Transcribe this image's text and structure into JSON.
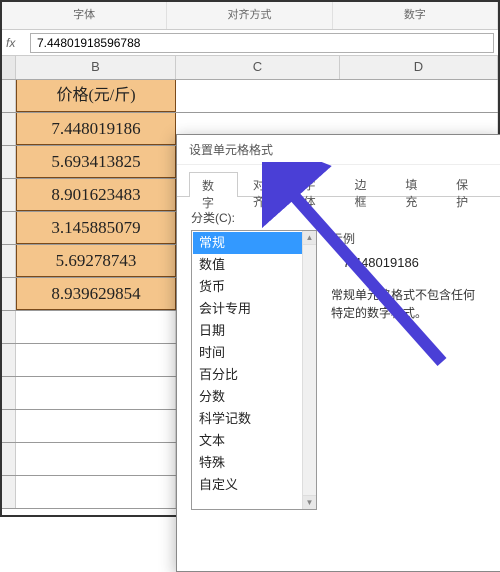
{
  "ribbon": {
    "groups": [
      "字体",
      "对齐方式",
      "数字"
    ]
  },
  "formula": {
    "fx": "fx",
    "value": "7.44801918596788"
  },
  "columns": [
    "B",
    "C",
    "D"
  ],
  "data_header": "价格(元/斤)",
  "data_rows": [
    "7.448019186",
    "5.693413825",
    "8.901623483",
    "3.145885079",
    "5.69278743",
    "8.939629854"
  ],
  "dialog": {
    "title": "设置单元格格式",
    "tabs": [
      "数字",
      "对齐",
      "字体",
      "边框",
      "填充",
      "保护"
    ],
    "active_tab": 0,
    "category_label": "分类(C):",
    "categories": [
      "常规",
      "数值",
      "货币",
      "会计专用",
      "日期",
      "时间",
      "百分比",
      "分数",
      "科学记数",
      "文本",
      "特殊",
      "自定义"
    ],
    "selected_index": 0,
    "example_label": "示例",
    "example_value": "7.448019186",
    "description": "常规单元格格式不包含任何特定的数字格式。"
  }
}
